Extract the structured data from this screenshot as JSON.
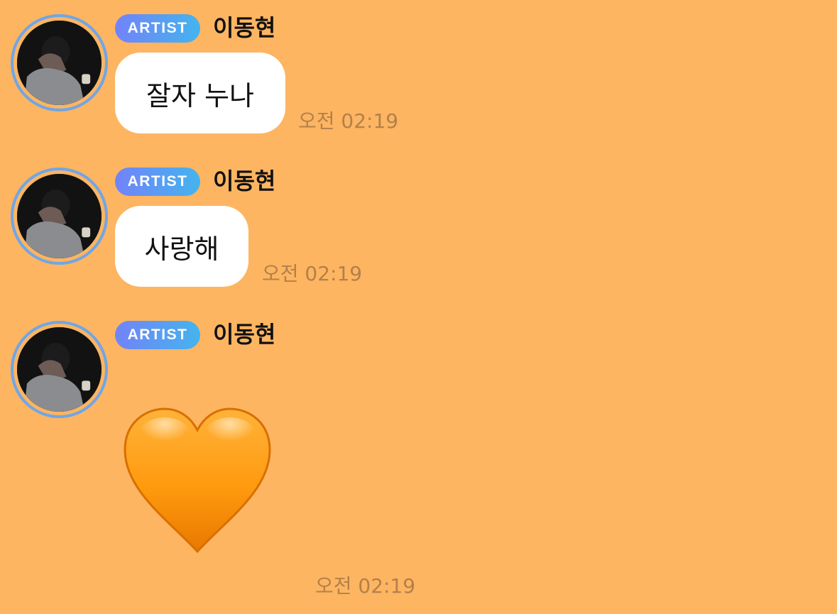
{
  "messages": [
    {
      "badge": "ARTIST",
      "sender": "이동현",
      "text": "잘자 누나",
      "time": "오전 02:19"
    },
    {
      "badge": "ARTIST",
      "sender": "이동현",
      "text": "사랑해",
      "time": "오전 02:19"
    },
    {
      "badge": "ARTIST",
      "sender": "이동현",
      "emoji": "orange-heart",
      "time": "오전 02:19"
    }
  ],
  "colors": {
    "background": "#FDB562",
    "badge_start": "#7283F8",
    "badge_end": "#44B4EE",
    "avatar_ring": "#6FA6E6",
    "heart": "#FF9500"
  }
}
